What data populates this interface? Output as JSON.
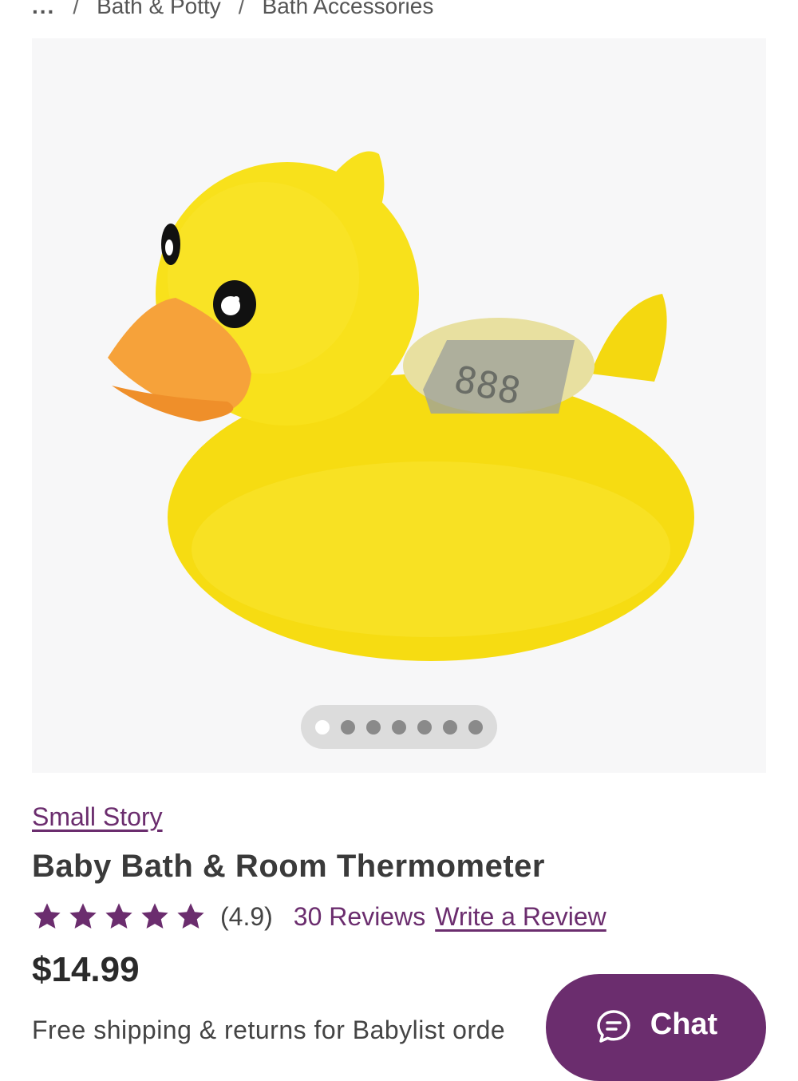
{
  "breadcrumb": {
    "ellipsis": "...",
    "items": [
      "Bath & Potty",
      "Bath Accessories"
    ],
    "separator": "/"
  },
  "product": {
    "brand": "Small Story",
    "title": "Baby Bath & Room Thermometer",
    "rating_display": "(4.9)",
    "rating_value": 4.9,
    "stars_filled": 5,
    "reviews_label": "30 Reviews",
    "write_review_label": "Write a Review",
    "price": "$14.99",
    "shipping_text": "Free shipping & returns for Babylist orde",
    "image_icon": "yellow-rubber-duck-thermometer"
  },
  "gallery": {
    "image_count": 7,
    "active_index": 0
  },
  "chat": {
    "label": "Chat",
    "icon": "chat-bubble-icon"
  },
  "colors": {
    "accent": "#6b2d6e",
    "duck_yellow": "#f7e21b",
    "beak_orange": "#f6a23a",
    "gallery_bg": "#f7f7f8"
  }
}
